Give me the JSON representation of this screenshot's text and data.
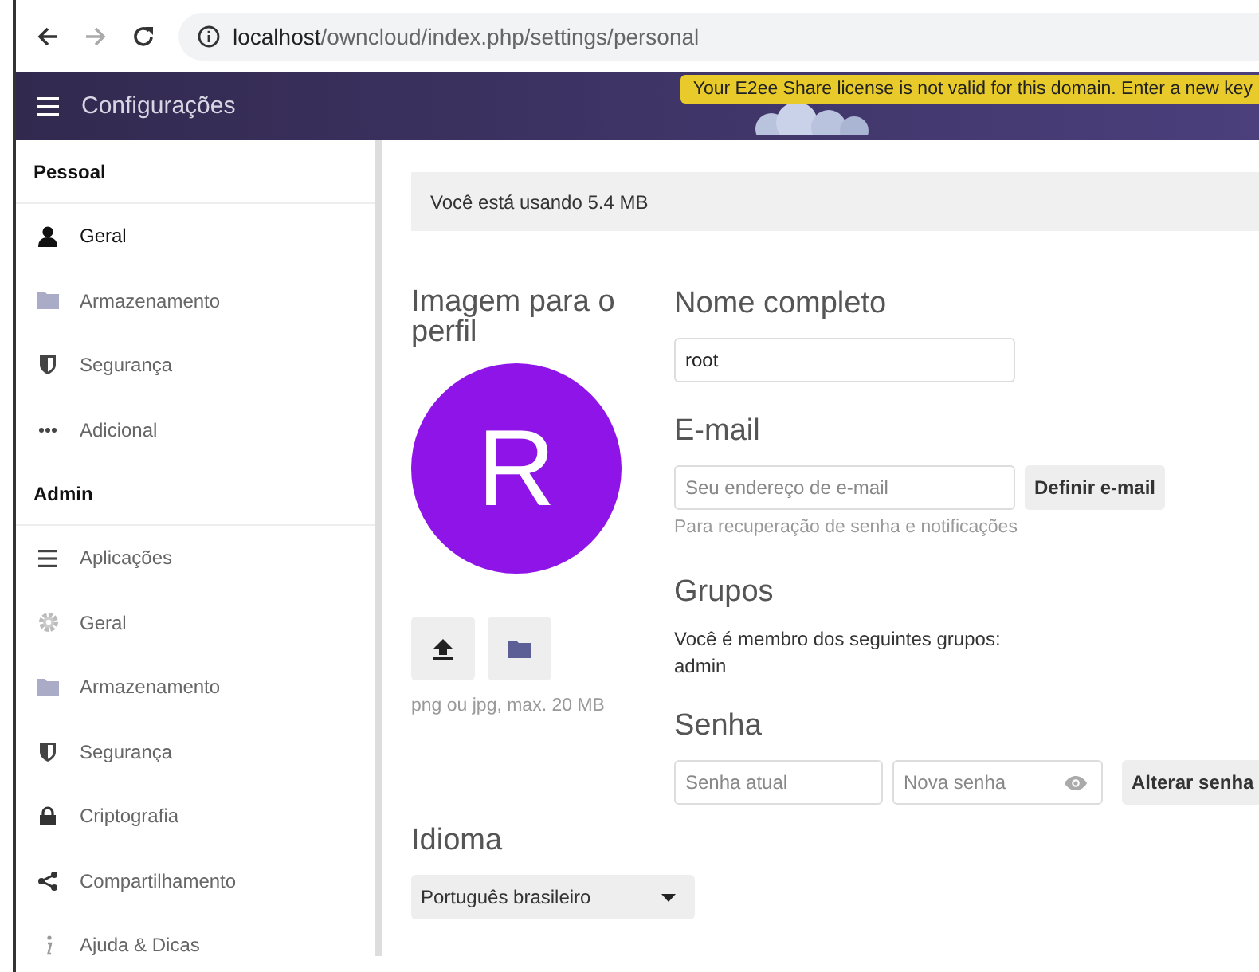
{
  "browser": {
    "nav_buttons": [
      {
        "kind": "back",
        "disabled": false
      },
      {
        "kind": "forward",
        "disabled": true
      },
      {
        "kind": "reload",
        "disabled": false
      }
    ],
    "url_host": "localhost",
    "url_path": "/owncloud/index.php/settings/personal"
  },
  "header": {
    "title": "Configurações"
  },
  "banner": "Your E2ee Share license is not valid for this domain. Enter a new key",
  "sidebar": {
    "sections": [
      {
        "title": "Pessoal",
        "items": [
          {
            "label": "Geral",
            "kind": "user",
            "selected": true
          },
          {
            "label": "Armazenamento",
            "kind": "folder",
            "selected": false
          },
          {
            "label": "Segurança",
            "kind": "shield",
            "selected": false
          },
          {
            "label": "Adicional",
            "kind": "dots",
            "selected": false
          }
        ]
      },
      {
        "title": "Admin",
        "items": [
          {
            "label": "Aplicações",
            "kind": "list",
            "selected": false
          },
          {
            "label": "Geral",
            "kind": "gear",
            "selected": false
          },
          {
            "label": "Armazenamento",
            "kind": "folder",
            "selected": false
          },
          {
            "label": "Segurança",
            "kind": "shield",
            "selected": false
          },
          {
            "label": "Criptografia",
            "kind": "lock",
            "selected": false
          },
          {
            "label": "Compartilhamento",
            "kind": "share",
            "selected": false
          },
          {
            "label": "Ajuda & Dicas",
            "kind": "info",
            "selected": false
          }
        ]
      }
    ]
  },
  "usage": "Você está usando 5.4 MB",
  "avatar": {
    "heading": "Imagem para o perfil",
    "initial": "R",
    "hint": "png ou jpg, max. 20 MB"
  },
  "full_name": {
    "heading": "Nome completo",
    "value": "root"
  },
  "email": {
    "heading": "E-mail",
    "placeholder": "Seu endereço de e-mail",
    "button": "Definir e-mail",
    "hint": "Para recuperação de senha e notificações"
  },
  "groups": {
    "heading": "Grupos",
    "text": "Você é membro dos seguintes grupos:",
    "list": [
      "admin"
    ]
  },
  "password": {
    "heading": "Senha",
    "current_placeholder": "Senha atual",
    "new_placeholder": "Nova senha",
    "button": "Alterar senha"
  },
  "language": {
    "heading": "Idioma",
    "value": "Português brasileiro"
  }
}
